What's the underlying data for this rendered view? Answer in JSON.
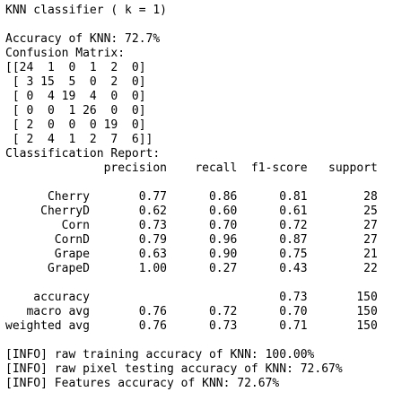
{
  "output": {
    "header": "KNN classifier ( k = 1)",
    "accuracy_line": "Accuracy of KNN: 72.7%",
    "confusion_matrix_label": "Confusion Matrix:",
    "confusion_matrix_lines": [
      "[[24  1  0  1  2  0]",
      " [ 3 15  5  0  2  0]",
      " [ 0  4 19  4  0  0]",
      " [ 0  0  1 26  0  0]",
      " [ 2  0  0  0 19  0]",
      " [ 2  4  1  2  7  6]]"
    ],
    "report_label": "Classification Report:",
    "report_header": "              precision    recall  f1-score   support",
    "report_rows": [
      "      Cherry       0.77      0.86      0.81        28",
      "     CherryD       0.62      0.60      0.61        25",
      "        Corn       0.73      0.70      0.72        27",
      "       CornD       0.79      0.96      0.87        27",
      "       Grape       0.63      0.90      0.75        21",
      "      GrapeD       1.00      0.27      0.43        22"
    ],
    "summary_rows": [
      "    accuracy                           0.73       150",
      "   macro avg       0.76      0.72      0.70       150",
      "weighted avg       0.76      0.73      0.71       150"
    ],
    "info_lines": [
      "[INFO] raw training accuracy of KNN: 100.00%",
      "[INFO] raw pixel testing accuracy of KNN: 72.67%",
      "[INFO] Features accuracy of KNN: 72.67%"
    ]
  }
}
